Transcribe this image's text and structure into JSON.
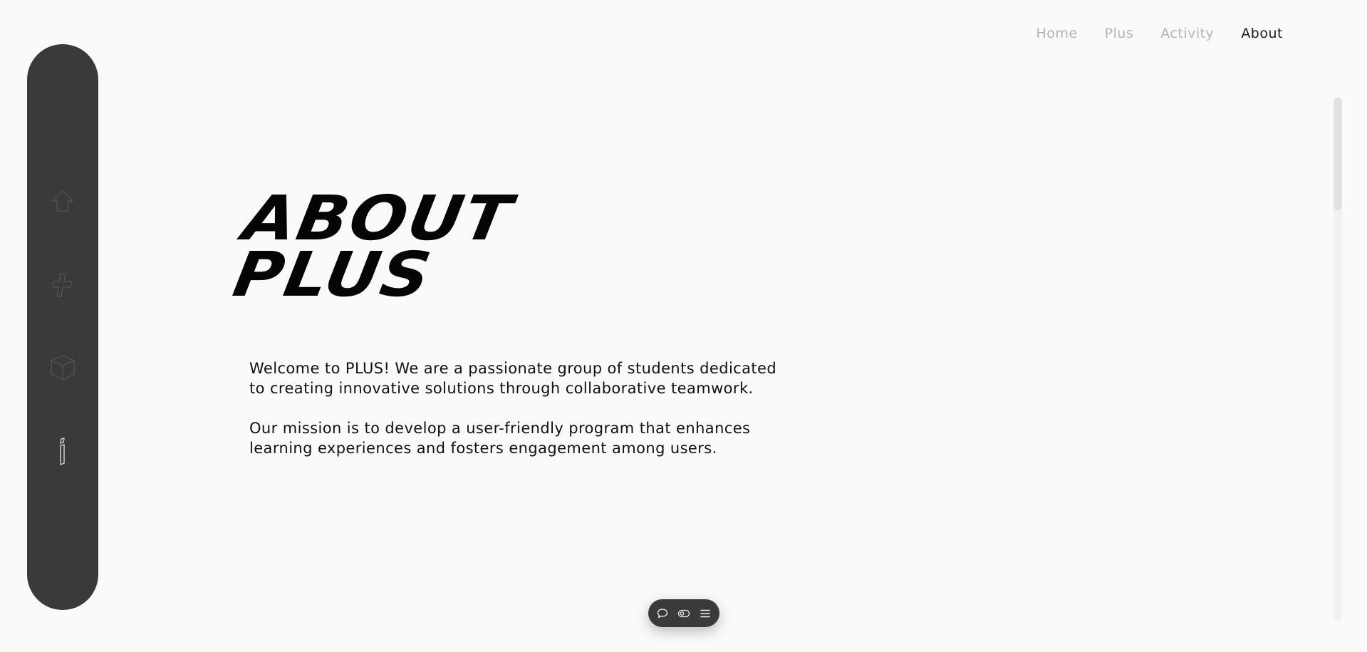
{
  "nav": {
    "items": [
      {
        "label": "Home",
        "active": false
      },
      {
        "label": "Plus",
        "active": false
      },
      {
        "label": "Activity",
        "active": false
      },
      {
        "label": "About",
        "active": true
      }
    ]
  },
  "sidebar": {
    "icons": [
      "home-icon",
      "plus-icon",
      "cube-icon",
      "info-icon"
    ],
    "background": "#3a3a3a"
  },
  "main": {
    "title_line1": "ABOUT",
    "title_line2": "PLUS",
    "paragraph1": "Welcome to PLUS! We are a passionate group of students dedicated to creating innovative solutions through collaborative teamwork.",
    "paragraph2": "Our mission is to develop a user-friendly program that enhances learning experiences and fosters engagement among users."
  },
  "toolbar": {
    "icons": [
      "chat-icon",
      "toggle-icon",
      "menu-icon"
    ]
  },
  "colors": {
    "background": "#fafafa",
    "nav_inactive": "#b4b4b4",
    "nav_active": "#1a1a1a",
    "dark": "#3a3a3a"
  }
}
